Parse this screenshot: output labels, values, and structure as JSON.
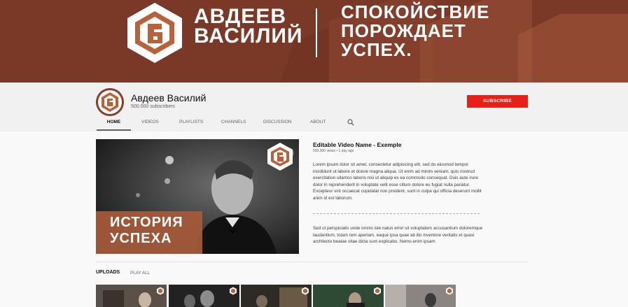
{
  "banner": {
    "name_line1": "АВДЕЕВ",
    "name_line2": "ВАСИЛИЙ",
    "motto_line1": "СПОКОЙСТВИЕ",
    "motto_line2": "ПОРОЖДАЕТ",
    "motto_line3": "УСПЕХ.",
    "brand_color": "#7a3826"
  },
  "channel": {
    "name": "Авдеев Василий",
    "subscribers": "500.000 subscribers",
    "subscribe_label": "SUBSCRIBE",
    "subscribe_color": "#e62117"
  },
  "tabs": [
    {
      "label": "HOME",
      "active": true
    },
    {
      "label": "VIDEOS",
      "active": false
    },
    {
      "label": "PLAYLISTS",
      "active": false
    },
    {
      "label": "CHANNELS",
      "active": false
    },
    {
      "label": "DISCUSSION",
      "active": false
    },
    {
      "label": "ABOUT",
      "active": false
    }
  ],
  "search_icon": "search-icon",
  "featured": {
    "overlay_line1": "ИСТОРИЯ",
    "overlay_line2": "УСПЕХА",
    "title": "Editable Video Name - Exemple",
    "meta": "500.000 views • 1 day ago",
    "description": "Lorem ipsum dolor sit amet, consectetur adipisicing elit, sed do eiusmod tempor incididunt ut labore et dolore magna aliqua. Ut enim ad minim veniam, quis nostrud exercitation ullamco laboris nisi ut aliquip ex ea commodo consequat. Duis aute irure dolor in reprehenderit in voluptate velit esse cillum dolore eu fugiat nulla pariatur. Excepteur sint occaecat cupidatat non proident, sunt in culpa qui officia deserunt mollit anim id est laborum.",
    "description2": "Sed ut perspiciatis unde omnis iste natus error sit voluptatem accusantium doloremque laudantium, totam rem aperiam, eaque ipsa quae ab illo inventore veritatis et quasi architecto beatae vitae dicta sunt explicabo. Nemo enim ipsam"
  },
  "uploads": {
    "label": "UPLOADS",
    "play_all": "PLAY ALL",
    "count": 5
  }
}
